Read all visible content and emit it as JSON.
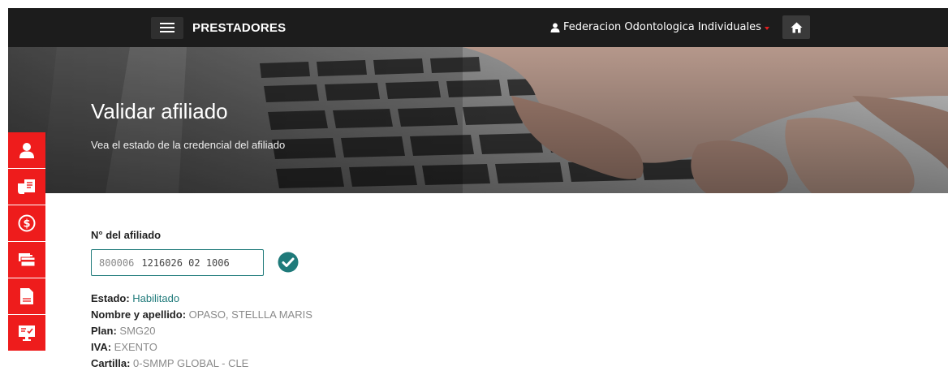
{
  "topbar": {
    "brand": "PRESTADORES",
    "user_name": "Federacion Odontologica Individuales",
    "icons": [
      "hamburger-icon",
      "user-icon",
      "home-icon"
    ]
  },
  "hero": {
    "title": "Validar afiliado",
    "subtitle": "Vea el estado de la credencial del afiliado"
  },
  "sidebar": {
    "items": [
      "user-icon",
      "invoice-icon",
      "dollar-icon",
      "card-icon",
      "document-icon",
      "monitor-icon"
    ]
  },
  "form": {
    "label": "N° del afiliado",
    "value_prefix": "800006",
    "value_main": "1216026 02 1006",
    "valid_icon": "check-circle-icon"
  },
  "result": {
    "estado_label": "Estado:",
    "estado_value": "Habilitado",
    "nombre_label": "Nombre y apellido:",
    "nombre_value": "OPASO, STELLLA MARIS",
    "plan_label": "Plan:",
    "plan_value": "SMG20",
    "iva_label": "IVA:",
    "iva_value": "EXENTO",
    "cartilla_label": "Cartilla:",
    "cartilla_value": "0-SMMP GLOBAL - CLE"
  },
  "colors": {
    "accent_red": "#ee1c1c",
    "accent_teal": "#1f7a7a",
    "topbar": "#1c1c1c"
  }
}
